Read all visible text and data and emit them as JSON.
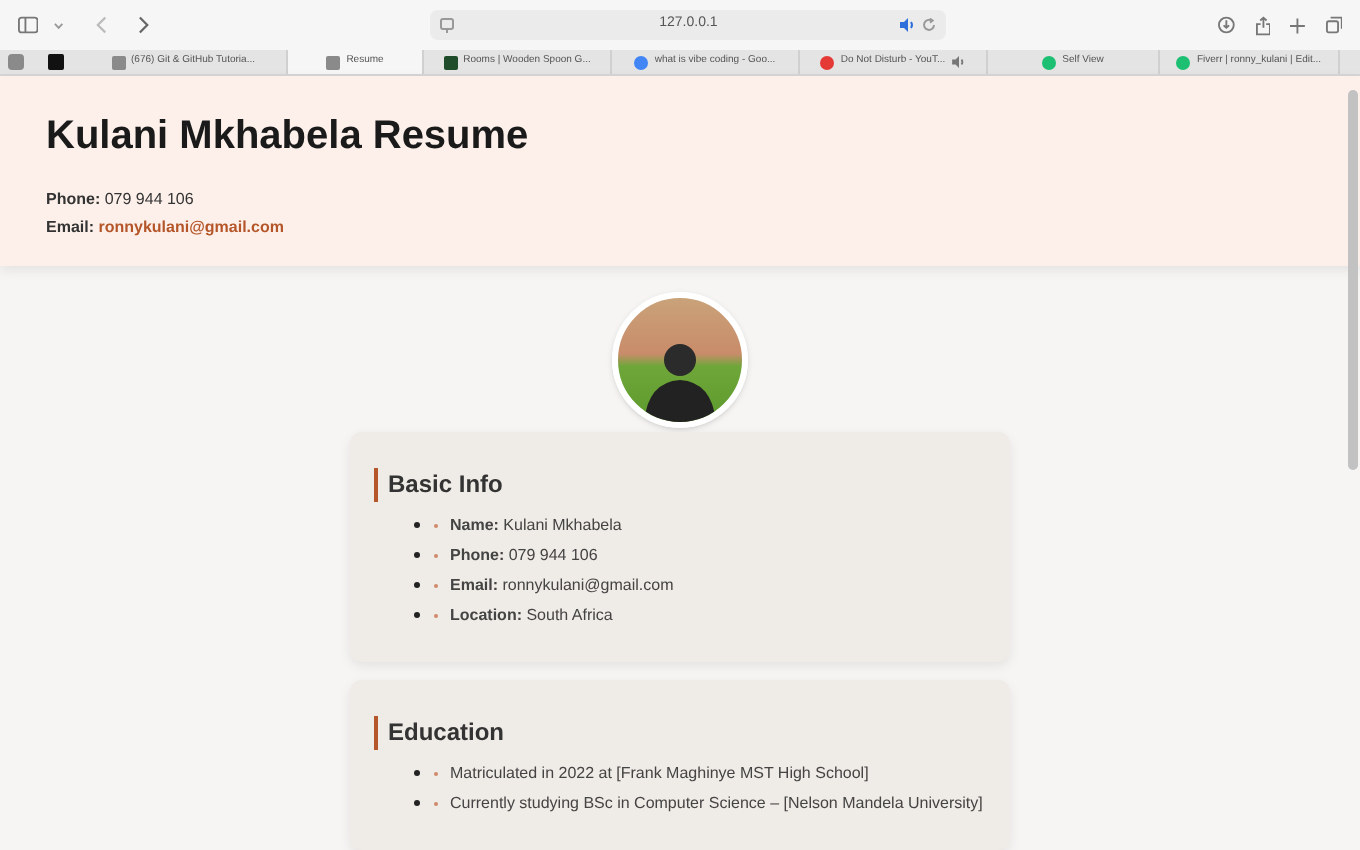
{
  "browser": {
    "url": "127.0.0.1",
    "tabs": [
      {
        "label": "(676) Git & GitHub Tutoria...",
        "selected": false,
        "playing_audio": false
      },
      {
        "label": "Resume",
        "selected": true,
        "playing_audio": false
      },
      {
        "label": "Rooms | Wooden Spoon G...",
        "selected": false,
        "playing_audio": false
      },
      {
        "label": "what is vibe coding - Goo...",
        "selected": false,
        "playing_audio": false
      },
      {
        "label": "Do Not Disturb - YouT...",
        "selected": false,
        "playing_audio": true
      },
      {
        "label": "Self View",
        "selected": false,
        "playing_audio": false
      },
      {
        "label": "Fiverr | ronny_kulani | Edit...",
        "selected": false,
        "playing_audio": false
      }
    ]
  },
  "header": {
    "title": "Kulani Mkhabela Resume",
    "contacts": [
      {
        "label": "Phone:",
        "value": "079 944 106",
        "kind": "text"
      },
      {
        "label": "Email:",
        "value": "ronnykulani@gmail.com",
        "kind": "link"
      }
    ]
  },
  "sections": [
    {
      "heading": "Basic Info",
      "items": [
        "**Name:** Kulani Mkhabela",
        "**Phone:** 079 944 106",
        "**Email:** ronnykulani@gmail.com",
        "**Location:** South Africa"
      ]
    },
    {
      "heading": "Education",
      "items": [
        "Matriculated in 2022 at [Frank Maghinye MST High School]",
        "Currently studying BSc in Computer Science – [Nelson Mandela University]"
      ]
    }
  ]
}
